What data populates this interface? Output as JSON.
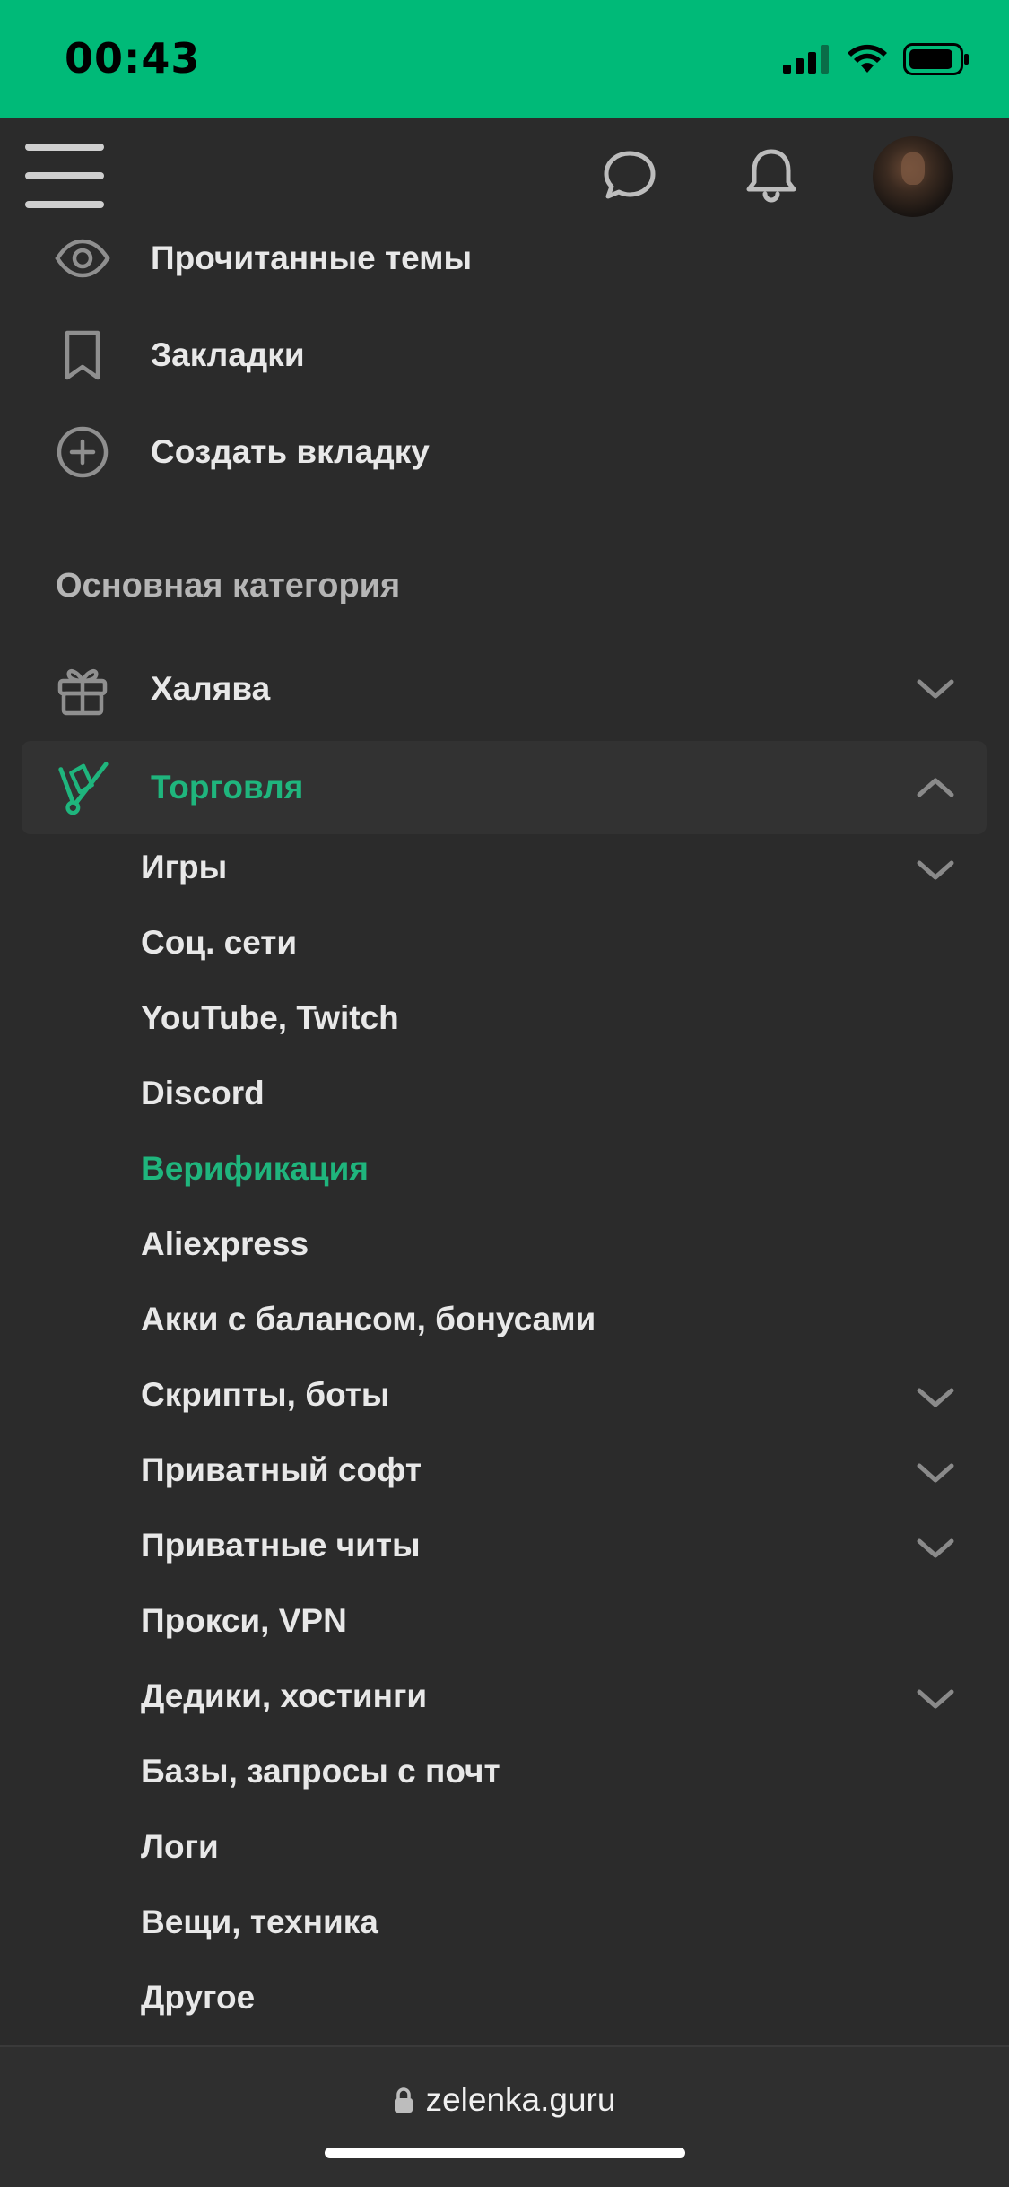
{
  "status": {
    "time": "00:43"
  },
  "topbar": {
    "icons": [
      "menu-icon",
      "chat-icon",
      "bell-icon",
      "avatar"
    ]
  },
  "menu": {
    "read_threads": "Прочитанные темы",
    "bookmarks": "Закладки",
    "create_tab": "Создать вкладку"
  },
  "section": {
    "title": "Основная категория",
    "freebies": "Халява",
    "trade": "Торговля"
  },
  "subitems": [
    {
      "label": "Игры",
      "expandable": true
    },
    {
      "label": "Соц. сети",
      "expandable": false
    },
    {
      "label": "YouTube, Twitch",
      "expandable": false
    },
    {
      "label": "Discord",
      "expandable": false
    },
    {
      "label": "Верификация",
      "expandable": false,
      "active": true
    },
    {
      "label": "Aliexpress",
      "expandable": false
    },
    {
      "label": "Акки с балансом, бонусами",
      "expandable": false
    },
    {
      "label": "Скрипты, боты",
      "expandable": true
    },
    {
      "label": "Приватный софт",
      "expandable": true
    },
    {
      "label": "Приватные читы",
      "expandable": true
    },
    {
      "label": "Прокси, VPN",
      "expandable": false
    },
    {
      "label": "Дедики, хостинги",
      "expandable": true
    },
    {
      "label": "Базы, запросы с почт",
      "expandable": false
    },
    {
      "label": "Логи",
      "expandable": false
    },
    {
      "label": "Вещи, техника",
      "expandable": false
    },
    {
      "label": "Другое",
      "expandable": false
    }
  ],
  "browser": {
    "url": "zelenka.guru"
  },
  "colors": {
    "accent": "#1fb57d",
    "status_bar": "#00ba78",
    "background": "#2b2b2b"
  }
}
